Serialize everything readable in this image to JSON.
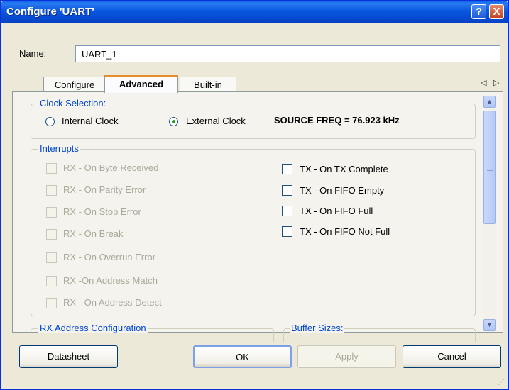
{
  "window": {
    "title": "Configure 'UART'",
    "help_glyph": "?",
    "close_glyph": "X"
  },
  "name": {
    "label": "Name:",
    "value": "UART_1"
  },
  "tabs": [
    {
      "label": "Configure"
    },
    {
      "label": "Advanced",
      "active": true
    },
    {
      "label": "Built-in"
    }
  ],
  "tab_scroll": {
    "left": "◁",
    "right": "▷"
  },
  "clock": {
    "title": "Clock Selection:",
    "internal_label": "Internal Clock",
    "external_label": "External Clock",
    "selected": "external",
    "source_freq": "SOURCE FREQ = 76.923 kHz"
  },
  "interrupts": {
    "title": "Interrupts",
    "rx": [
      {
        "label": "RX - On Byte Received",
        "checked": false,
        "enabled": false
      },
      {
        "label": "RX - On Parity Error",
        "checked": false,
        "enabled": false
      },
      {
        "label": "RX - On Stop Error",
        "checked": false,
        "enabled": false
      },
      {
        "label": "RX - On Break",
        "checked": false,
        "enabled": false
      },
      {
        "label": "RX - On Overrun Error",
        "checked": false,
        "enabled": false
      },
      {
        "label": "RX -On Address Match",
        "checked": false,
        "enabled": false
      },
      {
        "label": "RX - On Address Detect",
        "checked": false,
        "enabled": false
      }
    ],
    "tx": [
      {
        "label": "TX - On TX Complete",
        "checked": false,
        "enabled": true
      },
      {
        "label": "TX - On FIFO Empty",
        "checked": false,
        "enabled": true
      },
      {
        "label": "TX - On FIFO Full",
        "checked": false,
        "enabled": true
      },
      {
        "label": "TX - On FIFO Not Full",
        "checked": false,
        "enabled": true
      }
    ]
  },
  "rx_address": {
    "title": "RX Address Configuration"
  },
  "buffer_sizes": {
    "title": "Buffer Sizes:"
  },
  "buttons": {
    "datasheet": "Datasheet",
    "ok": "OK",
    "apply": "Apply",
    "cancel": "Cancel"
  },
  "colors": {
    "titlebar": "#0a5fe8",
    "group_title": "#0046d5",
    "active_tab_accent": "#e68b2c",
    "radio_dot": "#21a121"
  }
}
